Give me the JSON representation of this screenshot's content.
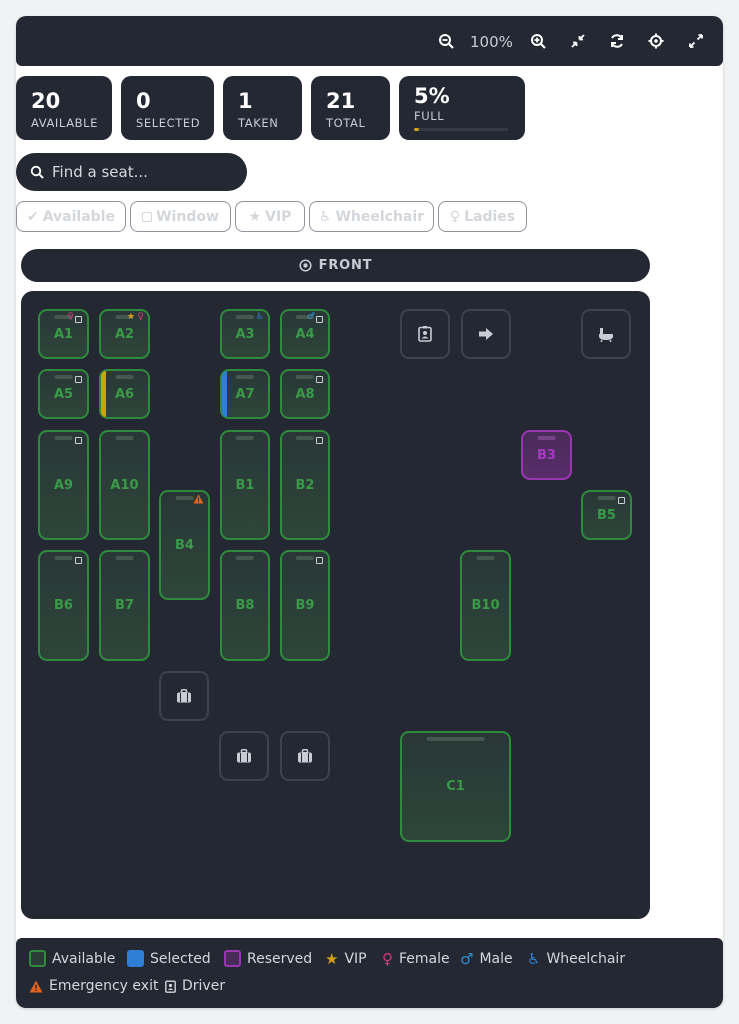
{
  "toolbar": {
    "zoom_text": "100%",
    "icons": [
      "zoom-out-icon",
      "zoom-in-icon",
      "collapse-icon",
      "refresh-icon",
      "settings-icon",
      "fullscreen-icon"
    ]
  },
  "stats": [
    {
      "value": "20",
      "label": "AVAILABLE"
    },
    {
      "value": "0",
      "label": "SELECTED"
    },
    {
      "value": "1",
      "label": "TAKEN"
    },
    {
      "value": "21",
      "label": "TOTAL"
    },
    {
      "value": "5%",
      "label": "FULL",
      "progress": 0.05
    }
  ],
  "search": {
    "placeholder": "Find a seat..."
  },
  "filters": [
    {
      "label": "Available",
      "icon": "check-icon"
    },
    {
      "label": "Window",
      "icon": "square-icon"
    },
    {
      "label": "VIP",
      "icon": "star-icon"
    },
    {
      "label": "Wheelchair",
      "icon": "wheelchair-icon"
    },
    {
      "label": "Ladies",
      "icon": "female-icon"
    }
  ],
  "front_label": "FRONT",
  "seats": {
    "A1": "A1",
    "A2": "A2",
    "A3": "A3",
    "A4": "A4",
    "A5": "A5",
    "A6": "A6",
    "A7": "A7",
    "A8": "A8",
    "A9": "A9",
    "A10": "A10",
    "B1": "B1",
    "B2": "B2",
    "B3": "B3",
    "B4": "B4",
    "B5": "B5",
    "B6": "B6",
    "B7": "B7",
    "B8": "B8",
    "B9": "B9",
    "B10": "B10",
    "C1": "C1"
  },
  "legend": {
    "available": "Available",
    "selected": "Selected",
    "reserved": "Reserved",
    "vip": "VIP",
    "female": "Female",
    "male": "Male",
    "wheelchair": "Wheelchair",
    "emergency": "Emergency exit",
    "driver": "Driver"
  },
  "colors": {
    "panel": "#242833",
    "available": "#2f8a3d",
    "selected": "#2f7fd6",
    "reserved": "#9b36b3",
    "vip": "#d4a017",
    "female": "#d13a7a",
    "male": "#2f8fd6",
    "emergency": "#e0621b"
  }
}
